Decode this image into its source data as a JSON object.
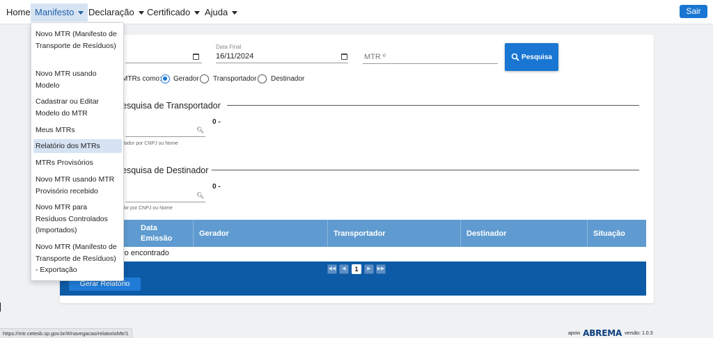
{
  "nav": {
    "home": "Home",
    "manifesto": "Manifesto",
    "declaracao": "Declaração",
    "certificado": "Certificado",
    "ajuda": "Ajuda",
    "sair": "Sair"
  },
  "dropdown": {
    "items": [
      "Novo MTR (Manifesto de Transporte de Resíduos)",
      "Novo MTR usando Modelo",
      "Cadastrar ou Editar Modelo do MTR",
      "Meus MTRs",
      "Relatório dos MTRs",
      "MTRs Provisórios",
      "Novo MTR usando MTR Provisório recebido",
      "Novo MTR para Resíduos Controlados (Importados)",
      "Novo MTR (Manifesto de Transporte de Resíduos) - Exportação"
    ],
    "highlighted_index": 4
  },
  "filters": {
    "data_final_label": "Data Final",
    "data_final_value": "16/11/2024",
    "mtr_placeholder": "MTR º",
    "pesquisa_button": "Pesquisa",
    "role_prefix": "MTRs como:",
    "roles": [
      "Gerador",
      "Transportador",
      "Destinador"
    ],
    "selected_role": "Gerador"
  },
  "transportador_section": {
    "title": "esquisa de Transportador",
    "count": "0 -",
    "hint": "rtador por CNPJ ou Nome"
  },
  "destinador_section": {
    "title": "esquisa de Destinador",
    "count": "0 -",
    "hint": "dor por CNPJ ou Nome"
  },
  "table": {
    "columns": [
      "Data Emissão",
      "Gerador",
      "Transportador",
      "Destinador",
      "Situação"
    ],
    "empty_message": "ro encontrado",
    "current_page": "1",
    "gerar_button": "Gerar Relatório"
  },
  "status_url": "https://mtr.cetesb.sp.gov.br/#/navegacao/relatorioMtr/1",
  "footer": {
    "apoio": "apoio",
    "logo": "ABREMA",
    "versao": "versão: 1.0.3"
  },
  "icons": {
    "calendar": "calendar-icon",
    "search": "search-icon",
    "pagination": [
      "first-page-icon",
      "prev-page-icon",
      "next-page-icon",
      "last-page-icon"
    ]
  },
  "colors": {
    "primary": "#1976d2",
    "table_header": "#5f9bd0",
    "table_footer": "#0d5ba6",
    "menu_highlight": "#d6e3f3"
  }
}
